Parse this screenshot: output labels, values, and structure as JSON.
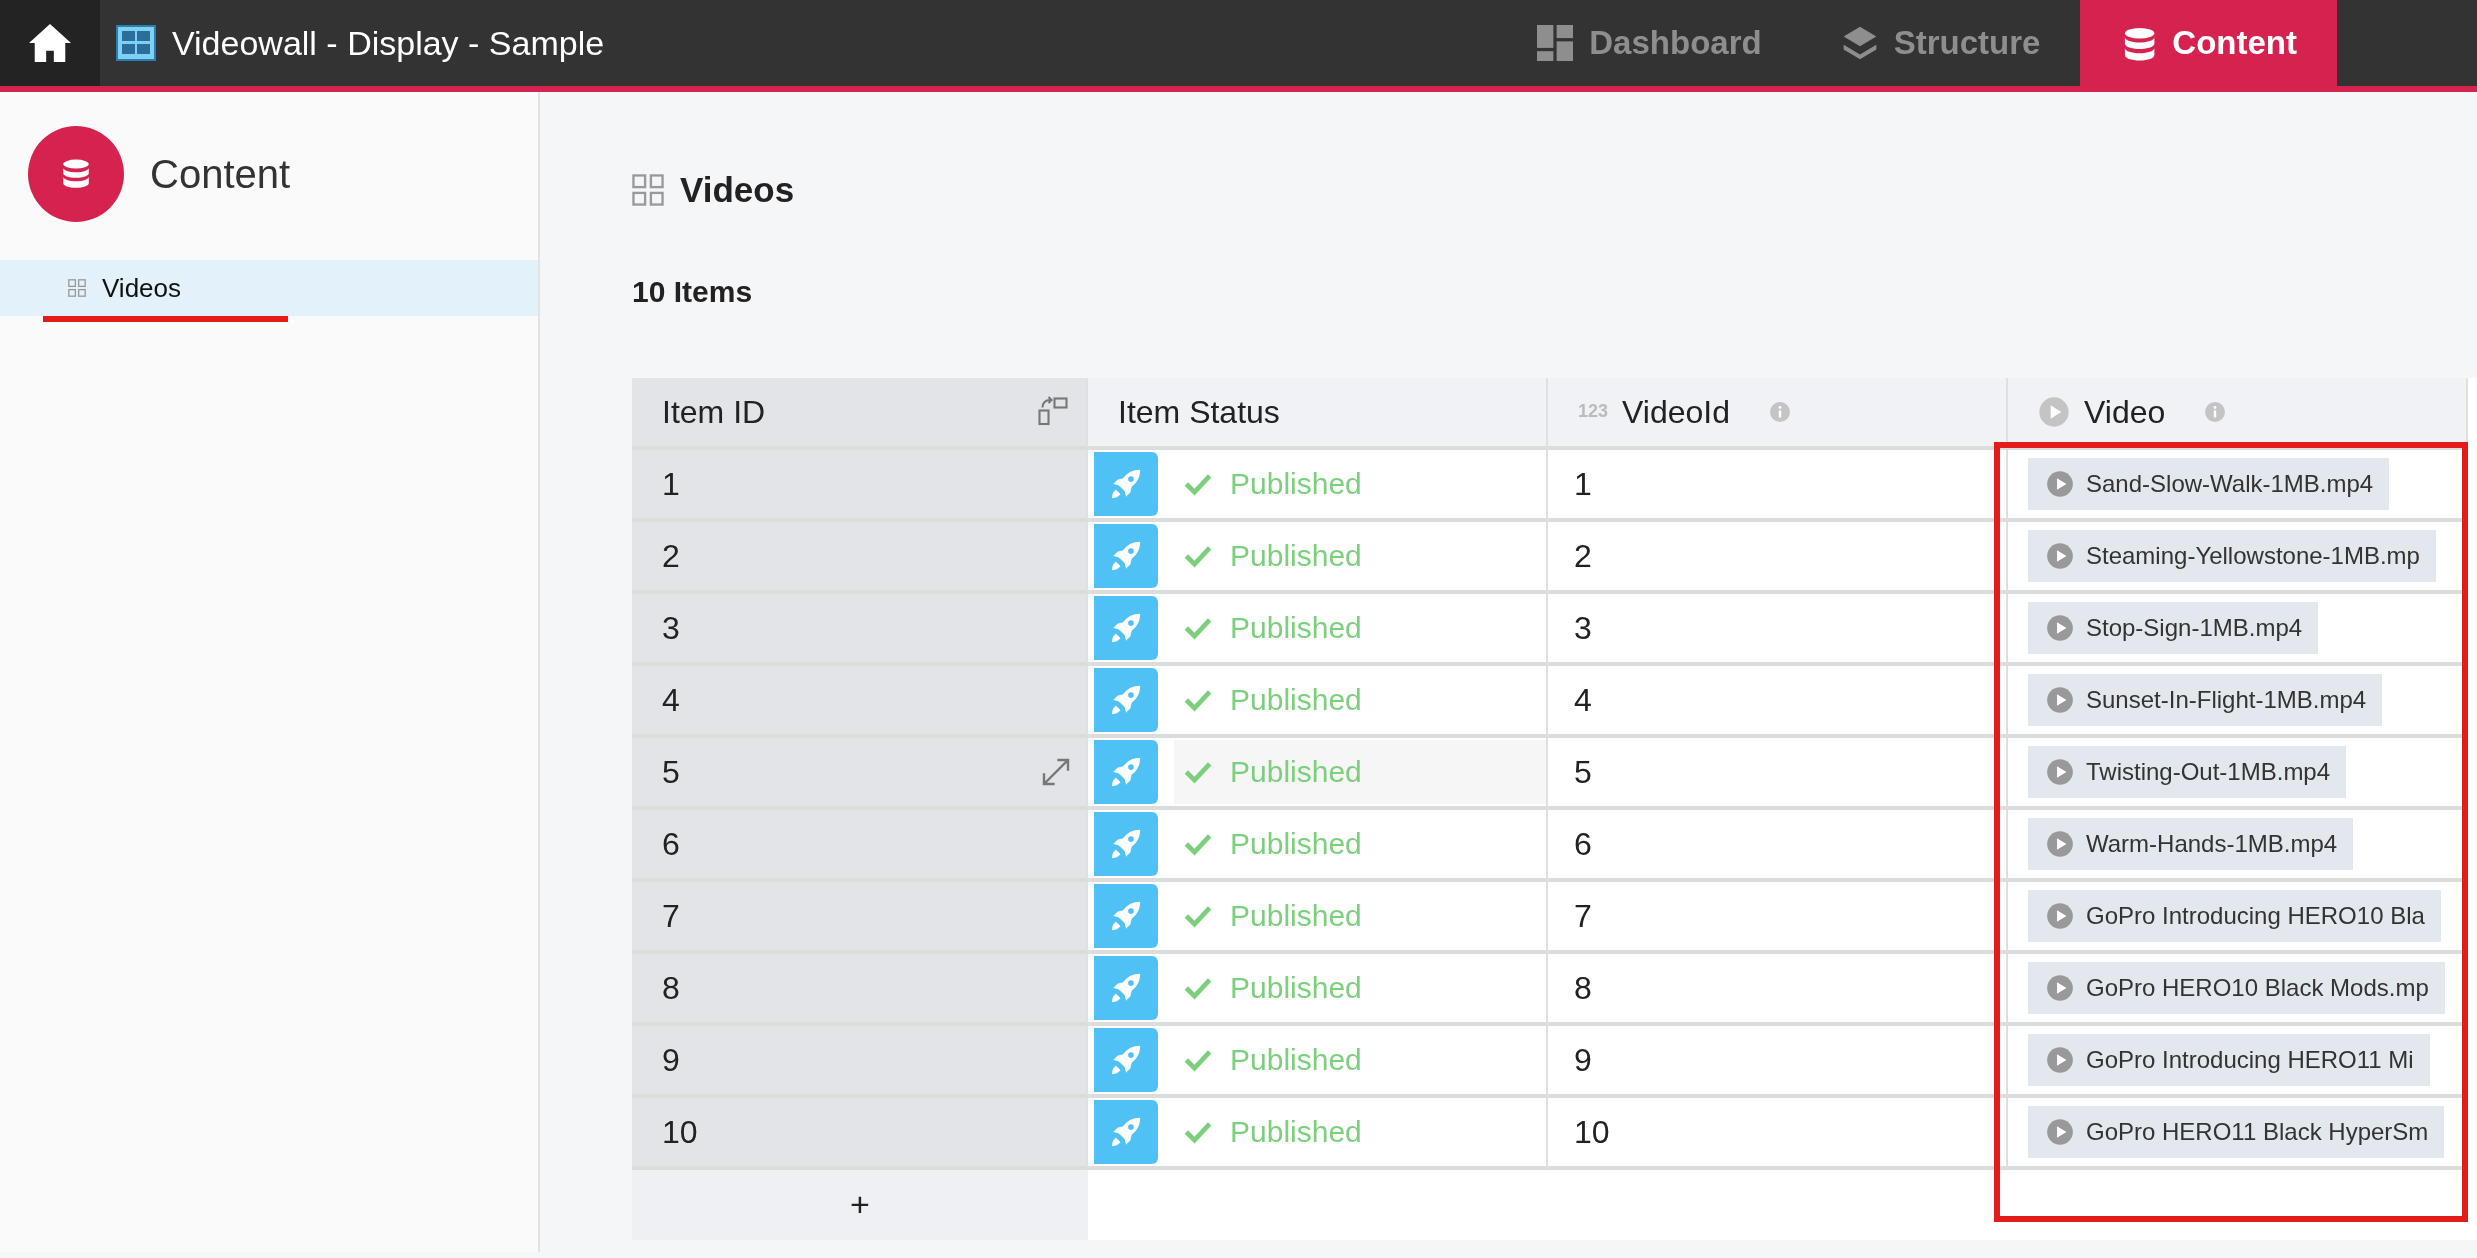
{
  "app": {
    "title": "Videowall - Display - Sample"
  },
  "nav_tabs": [
    {
      "label": "Dashboard",
      "kind": "dashboard",
      "selected": false
    },
    {
      "label": "Structure",
      "kind": "structure",
      "selected": false
    },
    {
      "label": "Content",
      "kind": "content",
      "selected": true
    }
  ],
  "sidebar": {
    "title": "Content",
    "items": [
      {
        "label": "Videos",
        "selected": true
      }
    ]
  },
  "page": {
    "title": "Videos",
    "count": "10 Items"
  },
  "table": {
    "columns": [
      {
        "label": "Item ID",
        "kind": "id"
      },
      {
        "label": "Item Status",
        "kind": "status"
      },
      {
        "label": "VideoId",
        "kind": "number",
        "prefix": "123"
      },
      {
        "label": "Video",
        "kind": "video"
      }
    ],
    "rows": [
      {
        "id": "1",
        "status": "Published",
        "video_id": "1",
        "video": "Sand-Slow-Walk-1MB.mp4",
        "hovered": false
      },
      {
        "id": "2",
        "status": "Published",
        "video_id": "2",
        "video": "Steaming-Yellowstone-1MB.mp",
        "hovered": false
      },
      {
        "id": "3",
        "status": "Published",
        "video_id": "3",
        "video": "Stop-Sign-1MB.mp4",
        "hovered": false
      },
      {
        "id": "4",
        "status": "Published",
        "video_id": "4",
        "video": "Sunset-In-Flight-1MB.mp4",
        "hovered": false
      },
      {
        "id": "5",
        "status": "Published",
        "video_id": "5",
        "video": "Twisting-Out-1MB.mp4",
        "hovered": true
      },
      {
        "id": "6",
        "status": "Published",
        "video_id": "6",
        "video": "Warm-Hands-1MB.mp4",
        "hovered": false
      },
      {
        "id": "7",
        "status": "Published",
        "video_id": "7",
        "video": "GoPro Introducing HERO10 Bla",
        "hovered": false
      },
      {
        "id": "8",
        "status": "Published",
        "video_id": "8",
        "video": "GoPro HERO10 Black Mods.mp",
        "hovered": false
      },
      {
        "id": "9",
        "status": "Published",
        "video_id": "9",
        "video": "GoPro Introducing HERO11 Mi",
        "hovered": false
      },
      {
        "id": "10",
        "status": "Published",
        "video_id": "10",
        "video": "GoPro HERO11 Black HyperSm",
        "hovered": false
      }
    ],
    "add_button": "+"
  }
}
